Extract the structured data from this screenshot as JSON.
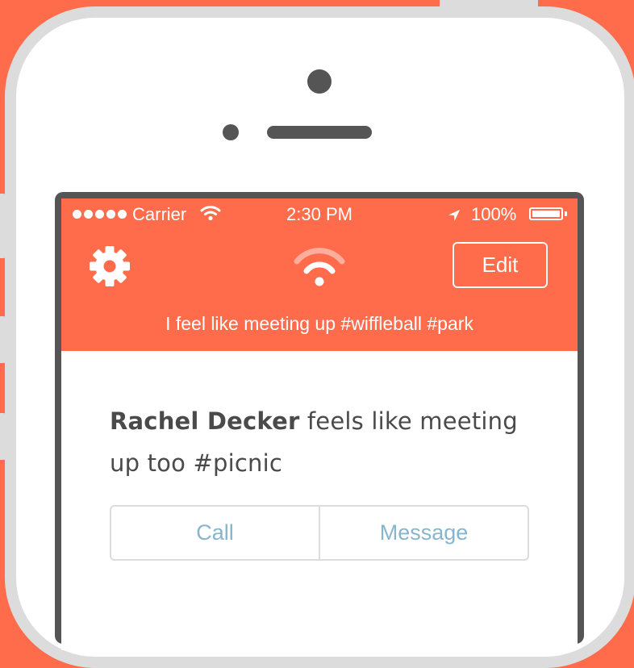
{
  "status_bar": {
    "carrier": "Carrier",
    "time": "2:30 PM",
    "battery": "100%",
    "battery_level": 1.0,
    "signal_bars": 5
  },
  "nav": {
    "settings_icon": "gear-icon",
    "logo_icon": "wifi-logo-icon",
    "edit_label": "Edit"
  },
  "status_message": "I feel like meeting up #wiffleball #park",
  "match": {
    "name": "Rachel Decker",
    "text": " feels like meeting up too #picnic"
  },
  "actions": {
    "call_label": "Call",
    "message_label": "Message"
  },
  "colors": {
    "accent": "#FF6C4C",
    "action_text": "#87B5CC",
    "body_text": "#4a4a4a",
    "phone_frame": "#dcdcdc",
    "bezel": "#555555"
  }
}
